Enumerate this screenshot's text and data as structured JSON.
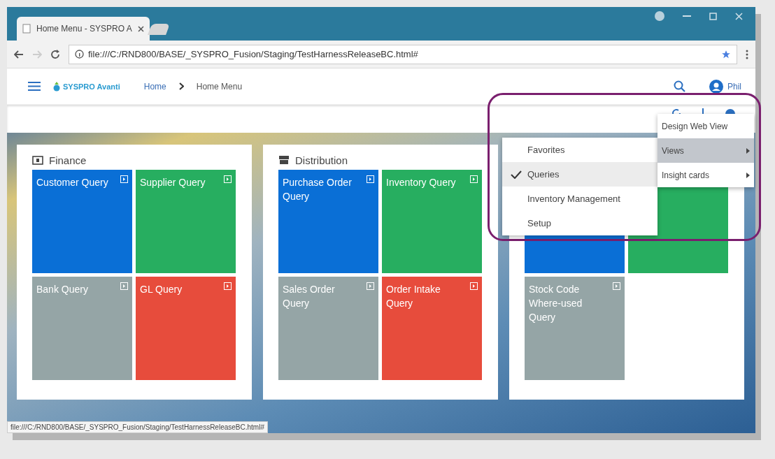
{
  "browser": {
    "tabs": [
      {
        "title": "Home Menu - SYSPRO A",
        "selected": true
      },
      {
        "selected": false
      }
    ],
    "address": "file:///C:/RND800/BASE/_SYSPRO_Fusion/Staging/TestHarnessReleaseBC.html#",
    "status_bar": "file:///C:/RND800/BASE/_SYSPRO_Fusion/Staging/TestHarnessReleaseBC.html#"
  },
  "header": {
    "logo": "SYSPRO Avanti",
    "breadcrumb": [
      "Home",
      "Home Menu"
    ],
    "user": "Phil"
  },
  "cards": [
    {
      "title": "Finance",
      "kind": "finance",
      "tiles": [
        {
          "title": "Customer Query",
          "color": "#0a6fd6"
        },
        {
          "title": "Supplier Query",
          "color": "#27ae60"
        },
        {
          "title": "Bank Query",
          "color": "#95a5a6"
        },
        {
          "title": "GL Query",
          "color": "#e74c3c"
        }
      ]
    },
    {
      "title": "Distribution",
      "kind": "distribution",
      "tiles": [
        {
          "title": "Purchase Order Query",
          "color": "#0a6fd6"
        },
        {
          "title": "Inventory Query",
          "color": "#27ae60"
        },
        {
          "title": "Sales Order Query",
          "color": "#95a5a6"
        },
        {
          "title": "Order Intake Query",
          "color": "#e74c3c"
        }
      ]
    },
    {
      "kind": "hidden",
      "tiles": [
        {
          "color": "#0a6fd6"
        },
        {
          "color": "#27ae60"
        },
        {
          "title": "Stock Code Where-used Query",
          "color": "#95a5a6"
        }
      ]
    }
  ],
  "menu": {
    "items": [
      {
        "label": "Design Web View",
        "selected": false,
        "submenu": false
      },
      {
        "label": "Views",
        "selected": true,
        "submenu": true
      },
      {
        "label": "Insight cards",
        "selected": false,
        "submenu": true
      }
    ],
    "submenu": [
      {
        "label": "Favorites",
        "checked": false,
        "selected": false
      },
      {
        "label": "Queries",
        "checked": true,
        "selected": true
      },
      {
        "label": "Inventory Management",
        "checked": false,
        "selected": false
      },
      {
        "label": "Setup",
        "checked": false,
        "selected": false
      }
    ]
  }
}
